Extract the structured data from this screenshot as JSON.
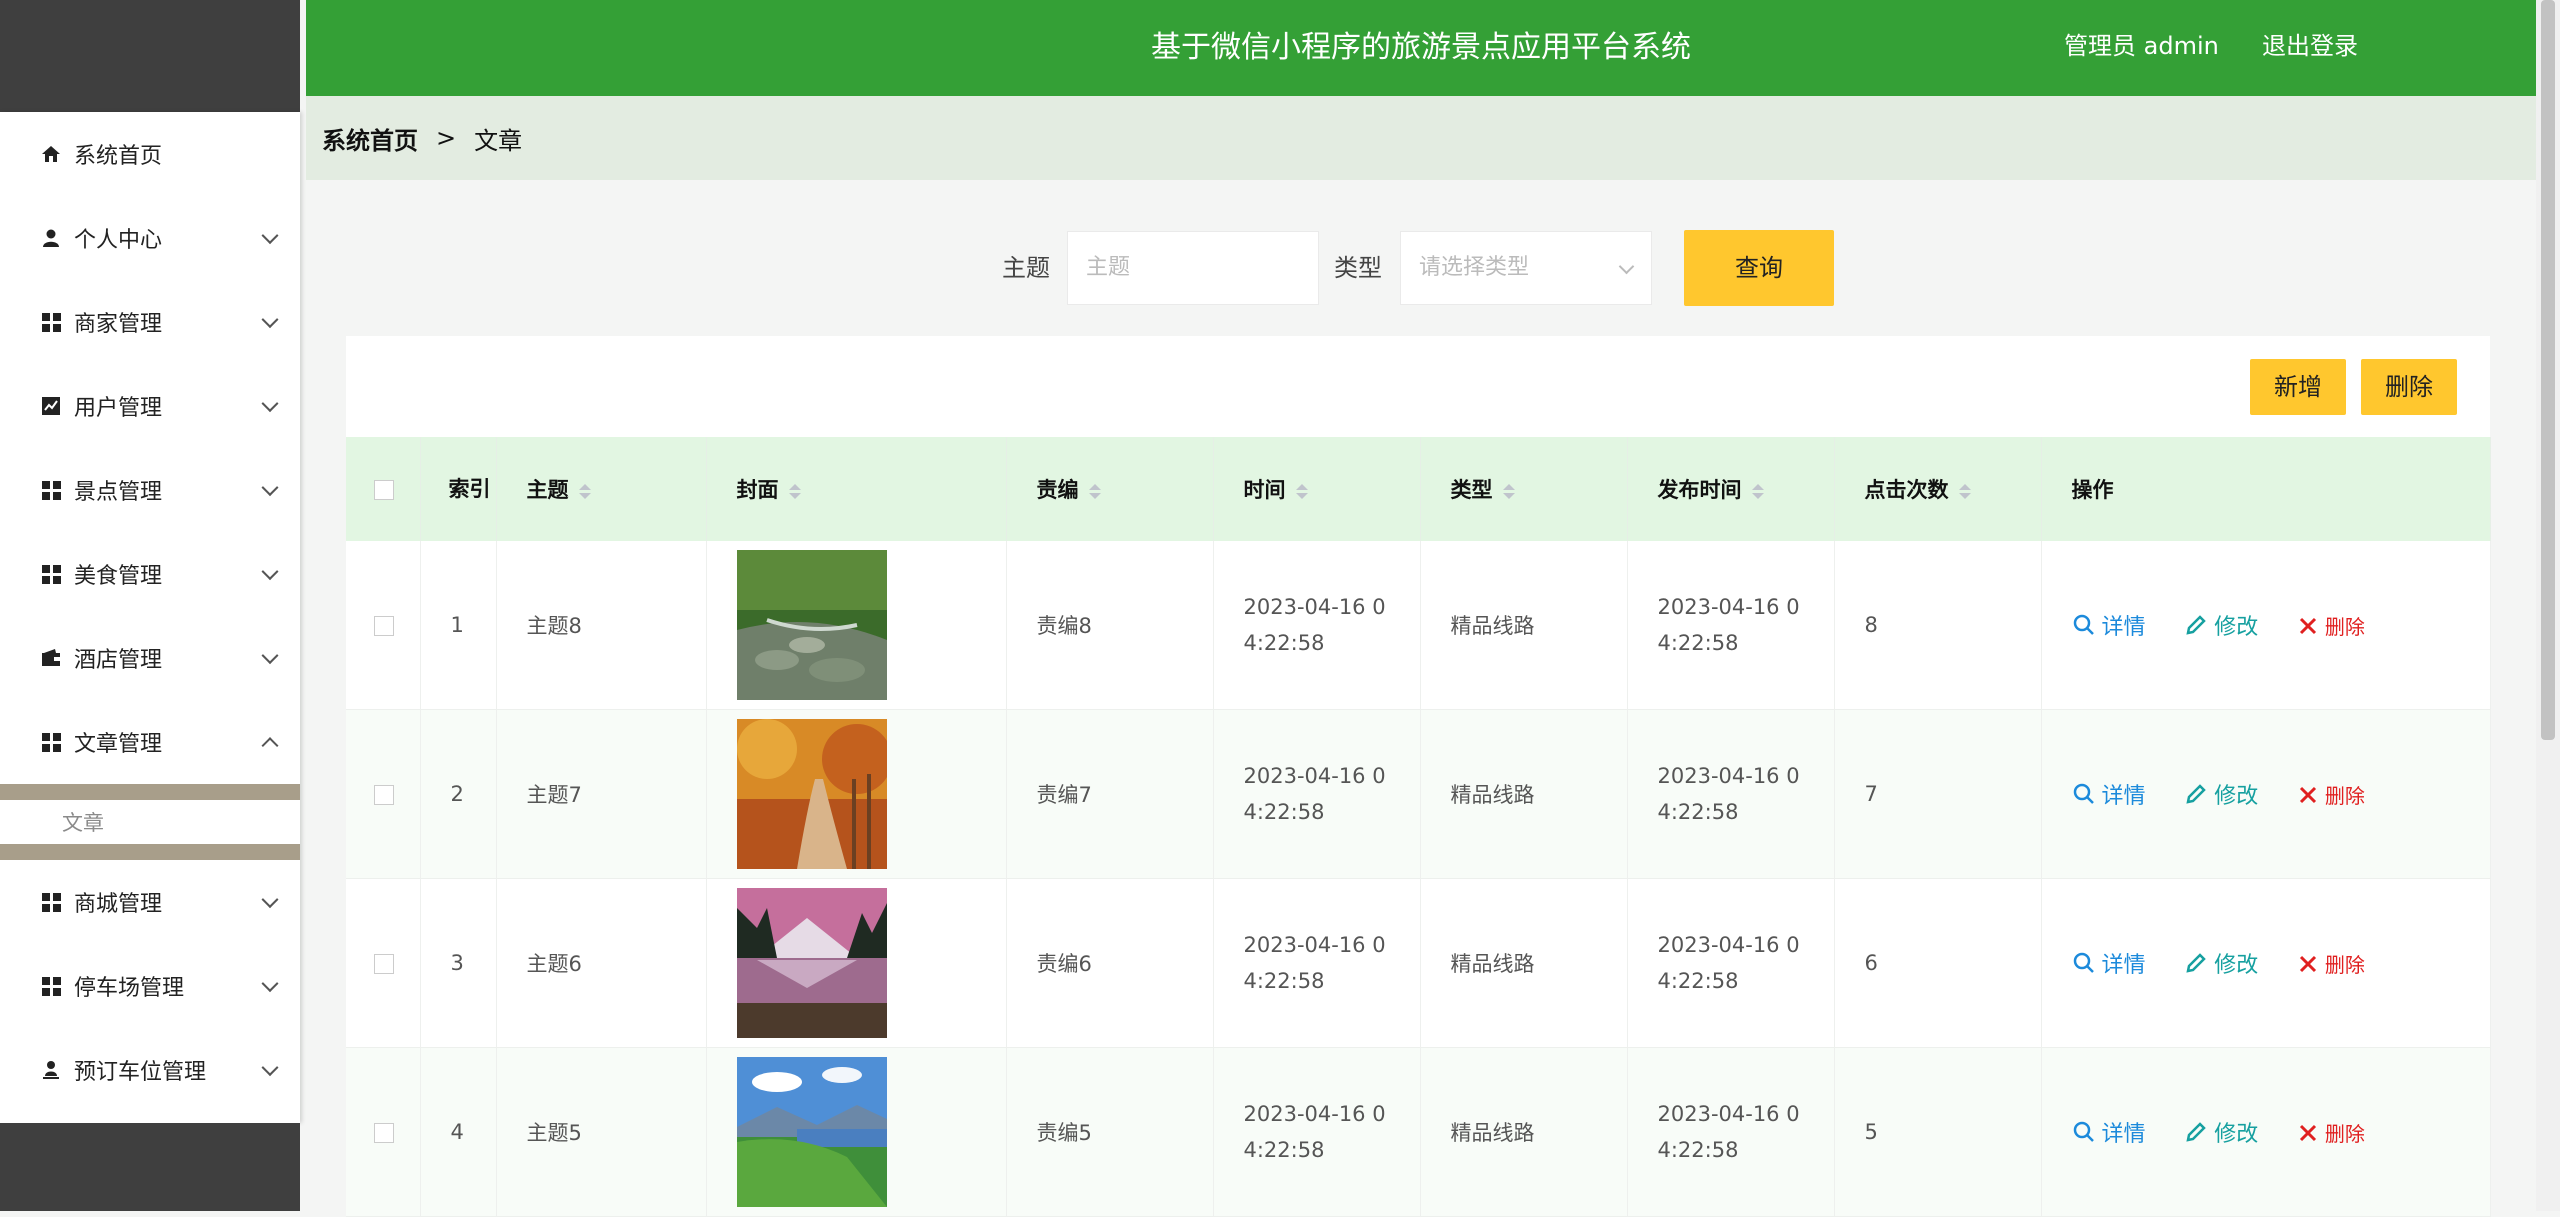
{
  "header": {
    "title": "基于微信小程序的旅游景点应用平台系统",
    "admin": "管理员 admin",
    "logout": "退出登录"
  },
  "sidebar": {
    "items": [
      {
        "label": "系统首页",
        "icon": "home-icon"
      },
      {
        "label": "个人中心",
        "icon": "user-icon"
      },
      {
        "label": "商家管理",
        "icon": "grid-icon"
      },
      {
        "label": "用户管理",
        "icon": "chart-icon"
      },
      {
        "label": "景点管理",
        "icon": "grid-icon"
      },
      {
        "label": "美食管理",
        "icon": "grid-icon"
      },
      {
        "label": "酒店管理",
        "icon": "wallet-icon"
      },
      {
        "label": "文章管理",
        "icon": "grid-icon"
      },
      {
        "label": "商城管理",
        "icon": "grid-icon"
      },
      {
        "label": "停车场管理",
        "icon": "grid-icon"
      },
      {
        "label": "预订车位管理",
        "icon": "person-stand-icon"
      }
    ],
    "submenu": {
      "label": "文章"
    }
  },
  "breadcrumb": {
    "home": "系统首页",
    "sep": ">",
    "current": "文章"
  },
  "search": {
    "subject_label": "主题",
    "subject_placeholder": "主题",
    "type_label": "类型",
    "type_placeholder": "请选择类型",
    "query_button": "查询"
  },
  "actions": {
    "add": "新增",
    "delete": "删除"
  },
  "table": {
    "headers": {
      "index": "索引",
      "subject": "主题",
      "cover": "封面",
      "editor": "责编",
      "time": "时间",
      "type": "类型",
      "publish_time": "发布时间",
      "clicks": "点击次数",
      "ops": "操作"
    },
    "rows": [
      {
        "index": "1",
        "subject": "主题8",
        "editor": "责编8",
        "time_a": "2023-04-16 0",
        "time_b": "4:22:58",
        "type": "精品线路",
        "pub_a": "2023-04-16 0",
        "pub_b": "4:22:58",
        "clicks": "8"
      },
      {
        "index": "2",
        "subject": "主题7",
        "editor": "责编7",
        "time_a": "2023-04-16 0",
        "time_b": "4:22:58",
        "type": "精品线路",
        "pub_a": "2023-04-16 0",
        "pub_b": "4:22:58",
        "clicks": "7"
      },
      {
        "index": "3",
        "subject": "主题6",
        "editor": "责编6",
        "time_a": "2023-04-16 0",
        "time_b": "4:22:58",
        "type": "精品线路",
        "pub_a": "2023-04-16 0",
        "pub_b": "4:22:58",
        "clicks": "6"
      },
      {
        "index": "4",
        "subject": "主题5",
        "editor": "责编5",
        "time_a": "2023-04-16 0",
        "time_b": "4:22:58",
        "type": "精品线路",
        "pub_a": "2023-04-16 0",
        "pub_b": "4:22:58",
        "clicks": "5"
      }
    ],
    "op_labels": {
      "detail": "详情",
      "edit": "修改",
      "delete": "删除"
    }
  },
  "colors": {
    "header": "#34a036",
    "accent_button": "#ffc72e",
    "table_header": "#e2f6e2"
  }
}
